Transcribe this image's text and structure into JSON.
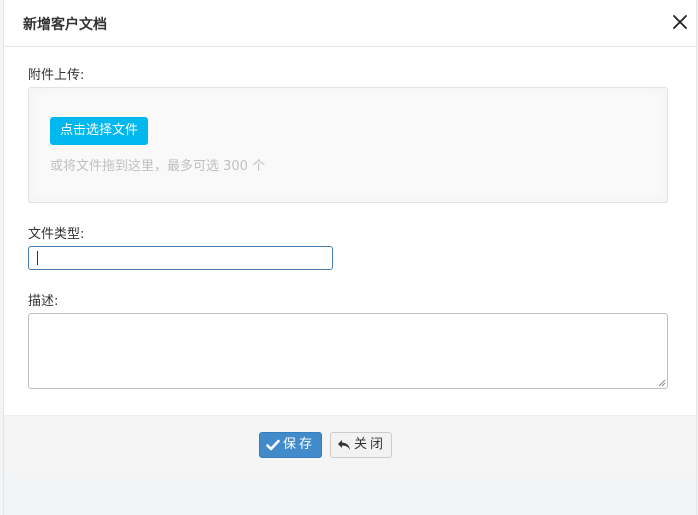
{
  "dialog": {
    "title": "新增客户文档"
  },
  "form": {
    "attachment_label": "附件上传:",
    "upload_button": "点击选择文件",
    "upload_hint": "或将文件拖到这里，最多可选 300 个",
    "file_type_label": "文件类型:",
    "file_type_value": "",
    "description_label": "描述:",
    "description_value": ""
  },
  "footer": {
    "save_label": "保存",
    "close_label": "关闭"
  },
  "colors": {
    "upload_button": "#00b7ee",
    "save_button": "#428bca"
  },
  "icons": {
    "close": "close-icon",
    "save": "check-icon",
    "back": "reply-icon"
  }
}
